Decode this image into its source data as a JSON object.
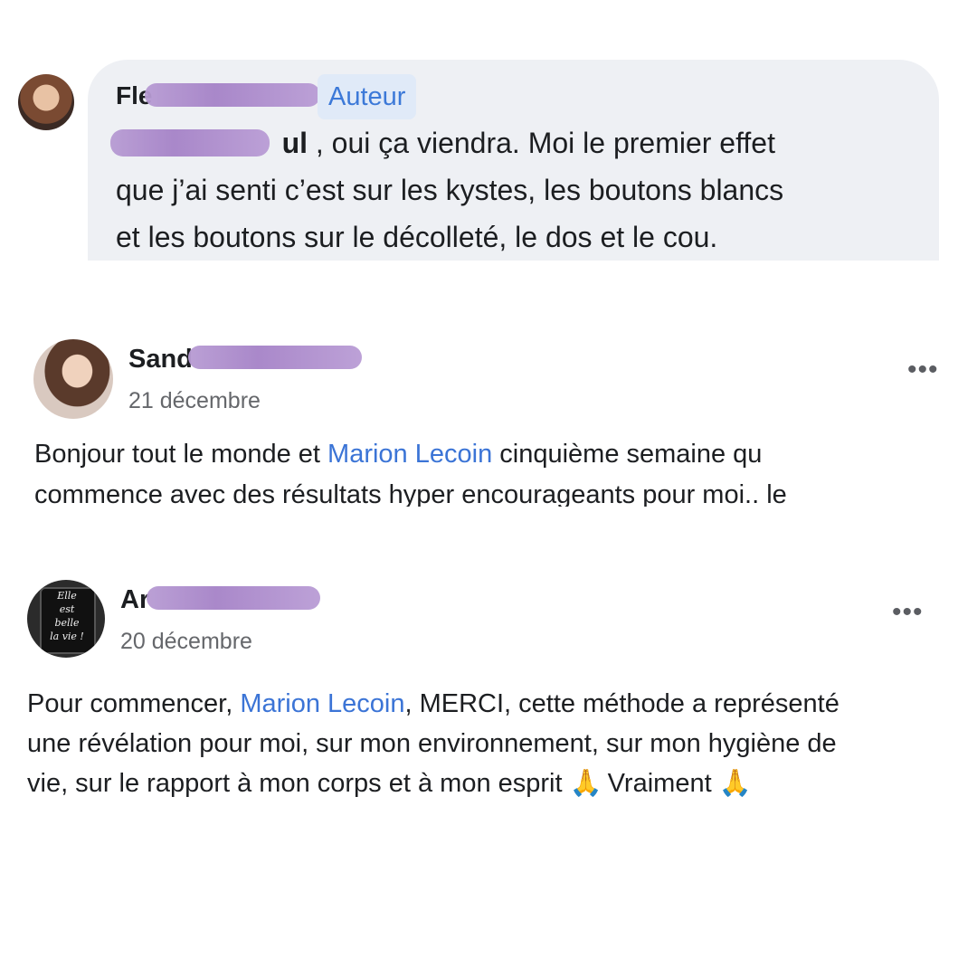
{
  "comment1": {
    "author_visible": "Fle",
    "badge": "Auteur",
    "mention_visible": "ul",
    "lines": [
      " , oui ça viendra. Moi le premier effet",
      "que j’ai senti c’est sur les kystes, les boutons blancs",
      "et les boutons sur le décolleté, le dos et le cou."
    ]
  },
  "post1": {
    "author_visible": "Sand",
    "date": "21 décembre",
    "more": "•••",
    "line1_prefix": "Bonjour tout le monde et ",
    "mention": "Marion Lecoin",
    "line1_suffix": " cinquième semaine qu",
    "line2": "commence avec des résultats hyper encourageants pour moi.. le"
  },
  "post2": {
    "author_visible": "Ar",
    "date": "20 décembre",
    "more": "•••",
    "avatar_text": [
      "Elle",
      "est",
      "belle",
      "la vie !"
    ],
    "line1_prefix": "Pour commencer, ",
    "mention": "Marion Lecoin",
    "line1_suffix": ", MERCI, cette méthode a représenté",
    "line2": "une révélation pour moi, sur mon environnement, sur mon hygiène de",
    "line3_prefix": "vie, sur le rapport à mon corps et à mon esprit ",
    "emoji": "🙏",
    "line3_mid": " Vraiment "
  },
  "colors": {
    "mention": "#3b74d6",
    "bubble": "#eef0f4",
    "badge_bg": "#e0eaf8",
    "redaction": "#a582c7"
  }
}
